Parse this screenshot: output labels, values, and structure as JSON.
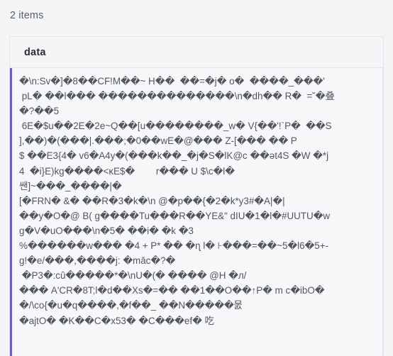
{
  "list": {
    "count_label": "2 items"
  },
  "table": {
    "columns": [
      {
        "key": "data",
        "label": "data"
      }
    ],
    "accent_color": "#6b5fc7",
    "header_bg": "#f4f5f7",
    "border_color": "#e3e5ea",
    "text_color": "#53565e",
    "rows": [
      {
        "data": "�\\n:Sv�]�8��CF!M��~ H��  ��=�j� o�  ����_���'\n pL� ��l��� ��������������\\n�dh�� R�  =˘�叠\n�?��5\n 6E�$u��2E�2e~Q��[u��������_w� V{��'!`P�  ��S\n],��)�(���|.���;�0��wE�@��� Z-[��� �� P\n$ ��E3{4� v6�A4y�(���k��_�j�S�lK@c ��ət4S �W �*j\n4  �i}E)kg����<ĸE$�        r��� U $\\c�l�\n쌘]~���_����|�\n[�FRN� &� ��R�3�k�\\n @�p��{�2�k*y3#�A|�|\n��y�O�@ B( g����Tu���R��YE&\" dIU�1�l�#UUTU�w\ng�V�uO���\\n�5� ��i� �k �3\n%������w��� �4 + P* �� �ɳ l� ⊦���=��~5�l6�5+-\ng!�e/���,����j: �mǎc�?�\n �P3�:cû�����*�\\nU�(� ���� @H �л/\n��� A'CR�8T;l�d��Xs�=�� ��1��O��↑P� m c�ibO�\n�/\\co{�u�q����,�f��_ ��N�����뭀\n�ajtO� �K��C�x53� �C���ef� 吃"
      }
    ]
  }
}
